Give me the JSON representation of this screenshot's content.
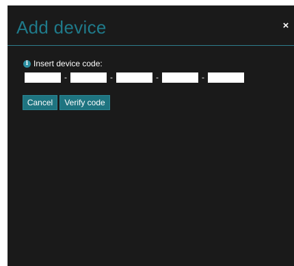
{
  "dialog": {
    "title": "Add device",
    "close_symbol": "×",
    "close_icon": "close-icon"
  },
  "form": {
    "info_icon": "info-icon",
    "info_symbol": "i",
    "label": "Insert device code:",
    "separator": "-",
    "code_fields": [
      {
        "value": ""
      },
      {
        "value": ""
      },
      {
        "value": ""
      },
      {
        "value": ""
      },
      {
        "value": ""
      }
    ]
  },
  "buttons": {
    "cancel_label": "Cancel",
    "verify_label": "Verify code"
  },
  "colors": {
    "dialog_background": "#1a1a1a",
    "accent": "#1f7a8a",
    "button_background": "#1e7480"
  }
}
